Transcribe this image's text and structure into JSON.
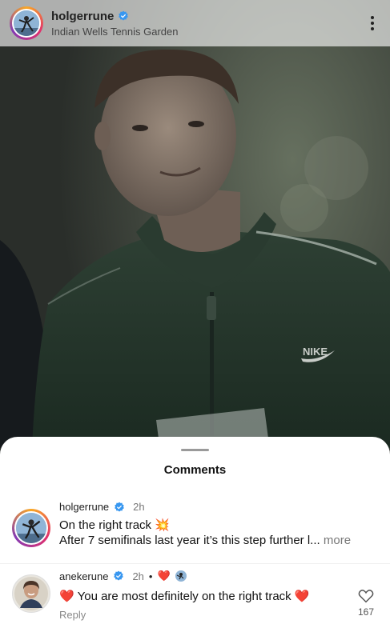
{
  "post": {
    "username": "holgerrune",
    "location": "Indian Wells Tennis Garden",
    "brand_on_jacket": "NIKE"
  },
  "comments_sheet": {
    "title": "Comments",
    "comments": [
      {
        "username": "holgerrune",
        "time": "2h",
        "line1": "On the right track",
        "line1_emoji": "💥",
        "line2": "After 7 semifinals last year it’s this step further l...",
        "more_label": "more"
      },
      {
        "username": "anekerune",
        "time": "2h",
        "time_dot": "•",
        "reaction_emojis": "❤️",
        "text_prefix_emoji": "❤️",
        "text": "You are most definitely on the right track",
        "text_suffix_emoji": "❤️",
        "reply_label": "Reply",
        "like_count": "167"
      }
    ]
  },
  "colors": {
    "verified_blue": "#3897f0",
    "heart_red": "#ed4956"
  }
}
